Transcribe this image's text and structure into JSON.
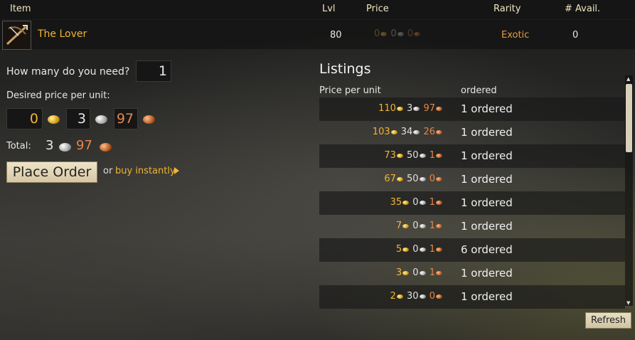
{
  "header": {
    "item": "Item",
    "lvl": "Lvl",
    "price": "Price",
    "rarity": "Rarity",
    "avail": "# Avail."
  },
  "item": {
    "name": "The Lover",
    "level": "80",
    "price_gold": "0",
    "price_silver": "0",
    "price_copper": "0",
    "rarity": "Exotic",
    "available": "0"
  },
  "order": {
    "quantity_label": "How many do you need?",
    "quantity": "1",
    "desired_label": "Desired price per unit:",
    "gold": "0",
    "silver": "3",
    "copper": "97",
    "total_label": "Total:",
    "total_silver": "3",
    "total_copper": "97",
    "place_order": "Place Order",
    "or_text": "or",
    "buy_instantly": "buy instantly"
  },
  "listings": {
    "title": "Listings",
    "col_price": "Price per unit",
    "col_ordered": "ordered",
    "rows": [
      {
        "gold": "110",
        "silver": "3",
        "copper": "97",
        "ordered": "1 ordered"
      },
      {
        "gold": "103",
        "silver": "34",
        "copper": "26",
        "ordered": "1 ordered"
      },
      {
        "gold": "73",
        "silver": "50",
        "copper": "1",
        "ordered": "1 ordered"
      },
      {
        "gold": "67",
        "silver": "50",
        "copper": "0",
        "ordered": "1 ordered"
      },
      {
        "gold": "35",
        "silver": "0",
        "copper": "1",
        "ordered": "1 ordered"
      },
      {
        "gold": "7",
        "silver": "0",
        "copper": "1",
        "ordered": "1 ordered"
      },
      {
        "gold": "5",
        "silver": "0",
        "copper": "1",
        "ordered": "6 ordered"
      },
      {
        "gold": "3",
        "silver": "0",
        "copper": "1",
        "ordered": "1 ordered"
      },
      {
        "gold": "2",
        "silver": "30",
        "copper": "0",
        "ordered": "1 ordered"
      }
    ],
    "refresh": "Refresh"
  },
  "icons": {
    "item": "crossbow-icon",
    "gold": "gold-coin-icon",
    "silver": "silver-coin-icon",
    "copper": "copper-coin-icon",
    "arrow": "triangle-right-icon"
  }
}
